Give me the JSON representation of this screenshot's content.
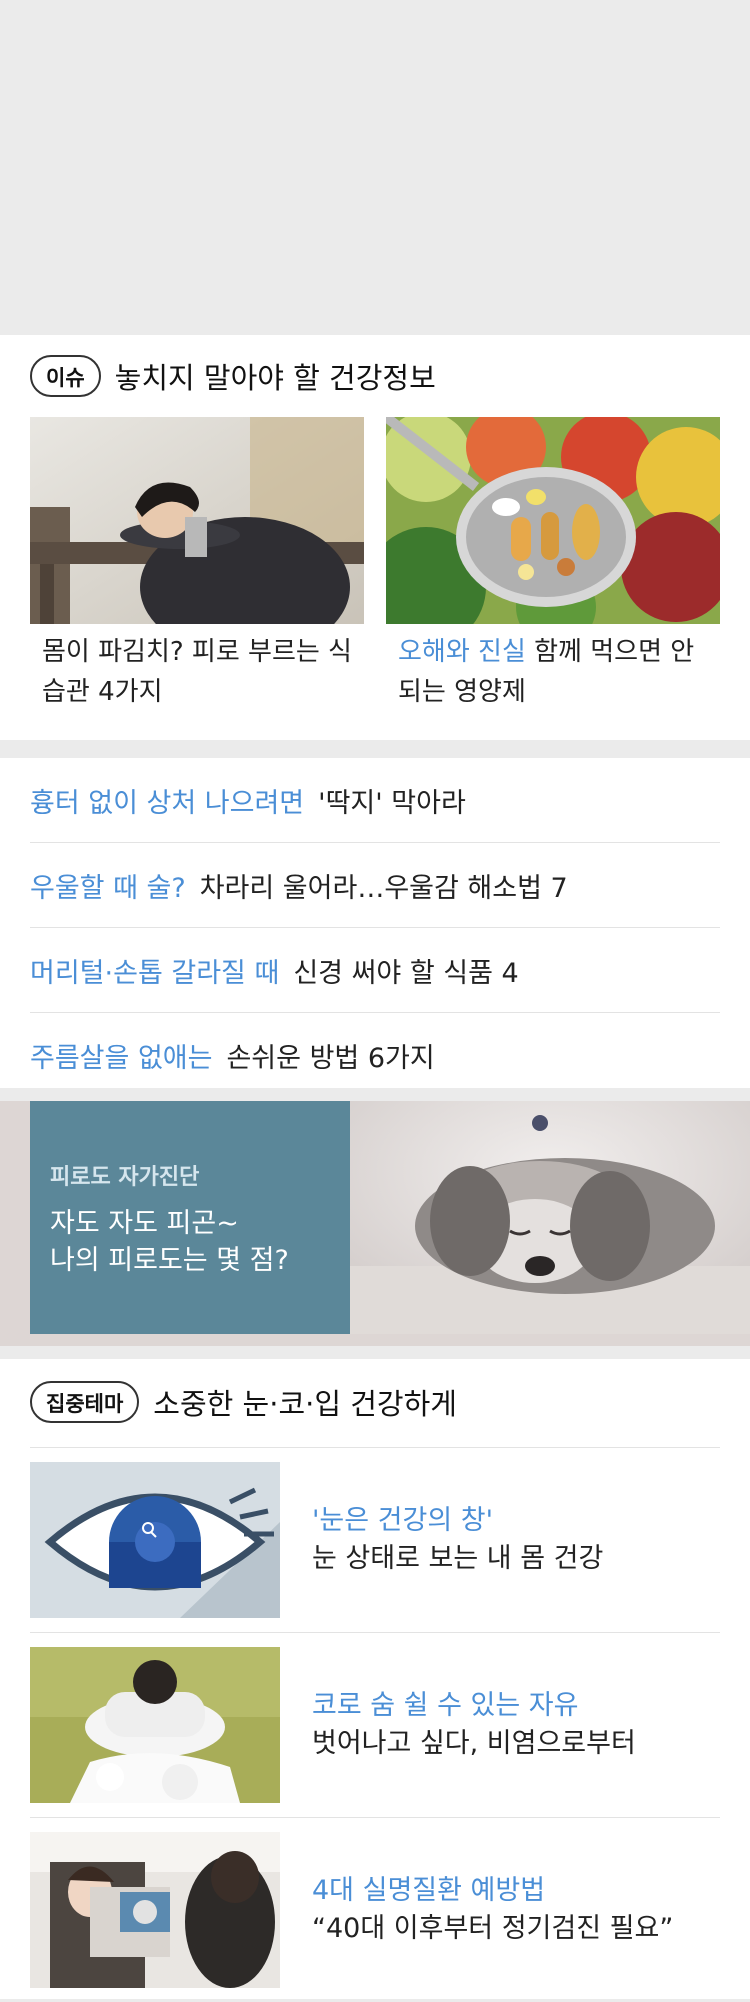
{
  "issue": {
    "badge": "이슈",
    "title": "놓치지 말아야 할 건강정보",
    "cards": [
      {
        "highlight": "",
        "text": "몸이 파김치? 피로 부르는 식습관 4가지",
        "image": "tired-woman-photo"
      },
      {
        "highlight": "오해와 진실",
        "text": "함께 먹으면 안 되는 영양제",
        "image": "vitamin-spoon-photo"
      }
    ]
  },
  "links": [
    {
      "highlight": "흉터 없이 상처 나으려면",
      "text": "'딱지' 막아라"
    },
    {
      "highlight": "우울할 때 술?",
      "text": "차라리 울어라…우울감 해소법 7"
    },
    {
      "highlight": "머리털·손톱 갈라질 때",
      "text": "신경 써야 할 식품 4"
    },
    {
      "highlight": "주름살을 없애는",
      "text": "손쉬운 방법 6가지"
    }
  ],
  "banner": {
    "subtitle": "피로도 자가진단",
    "line1": "자도 자도 피곤~",
    "line2": "나의 피로도는 몇 점?",
    "image": "sleeping-dog-photo"
  },
  "theme": {
    "badge": "집중테마",
    "title": "소중한 눈·코·입 건강하게",
    "items": [
      {
        "highlight": "'눈은 건강의 창'",
        "text": "눈 상태로 보는 내 몸 건강",
        "image": "eye-illustration"
      },
      {
        "highlight": "코로 숨 쉴 수 있는 자유",
        "text": "벗어나고 싶다, 비염으로부터",
        "image": "tissue-person-photo"
      },
      {
        "highlight": "4대 실명질환 예방법",
        "text": "“40대 이후부터 정기검진 필요”",
        "image": "eye-exam-photo"
      }
    ]
  },
  "colors": {
    "accent": "#4a8ed6",
    "banner_bg": "#5b8799",
    "page_bg": "#ebebeb"
  }
}
